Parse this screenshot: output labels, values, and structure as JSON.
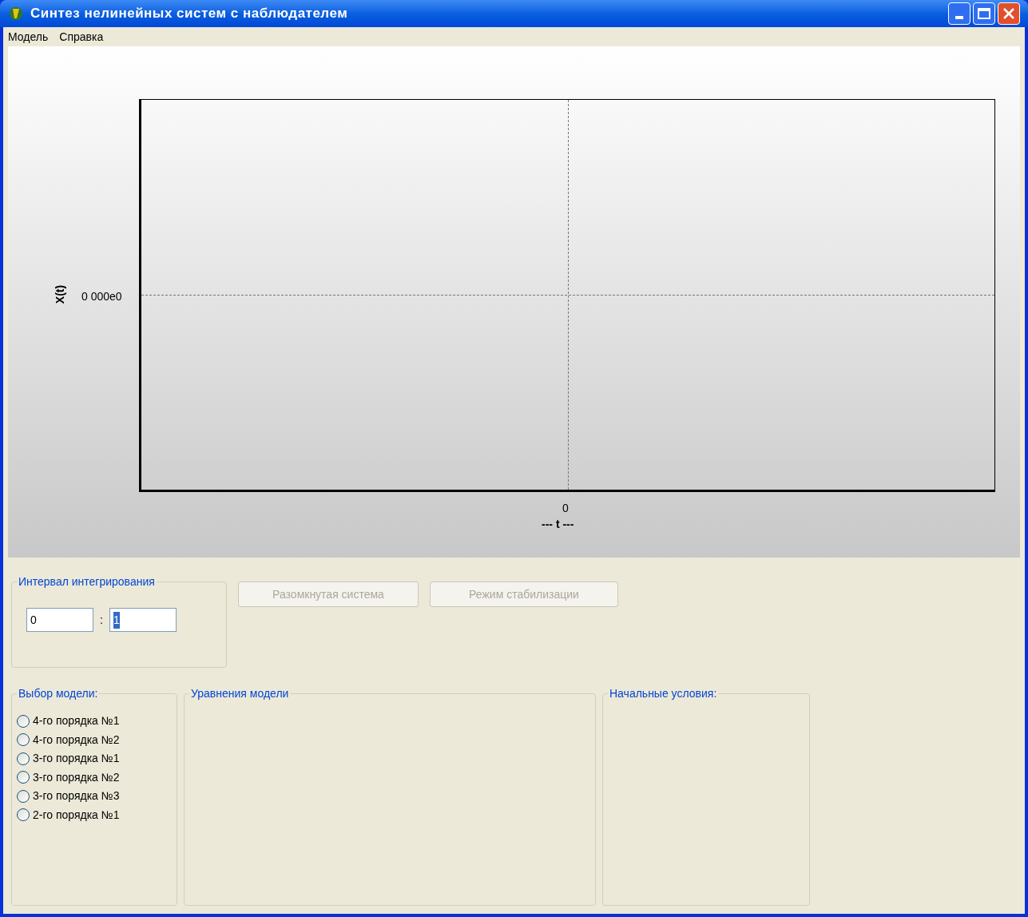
{
  "window": {
    "title": "Синтез нелинейных систем с наблюдателем"
  },
  "menu": [
    "Модель",
    "Справка"
  ],
  "plot": {
    "ylabel": "X(t)",
    "ytick": "0 000e0",
    "xtick": "0",
    "xlabel": "--- t ---"
  },
  "interval": {
    "title": "Интервал интегрирования",
    "from": "0",
    "separator": ":",
    "to": "1",
    "to_selected": true
  },
  "buttons": [
    {
      "label": "Разомкнутая система",
      "disabled": true
    },
    {
      "label": "Режим стабилизации",
      "disabled": true
    }
  ],
  "model_choice": {
    "title": "Выбор модели:",
    "options": [
      {
        "label": "4-го порядка №1",
        "selected": false
      },
      {
        "label": "4-го порядка №2",
        "selected": false
      },
      {
        "label": "3-го порядка №1",
        "selected": false
      },
      {
        "label": "3-го порядка №2",
        "selected": false
      },
      {
        "label": "3-го порядка №3",
        "selected": false
      },
      {
        "label": "2-го порядка №1",
        "selected": false
      }
    ]
  },
  "equations": {
    "title": "Уравнения модели"
  },
  "initial_conditions": {
    "title": "Начальные условия:"
  }
}
